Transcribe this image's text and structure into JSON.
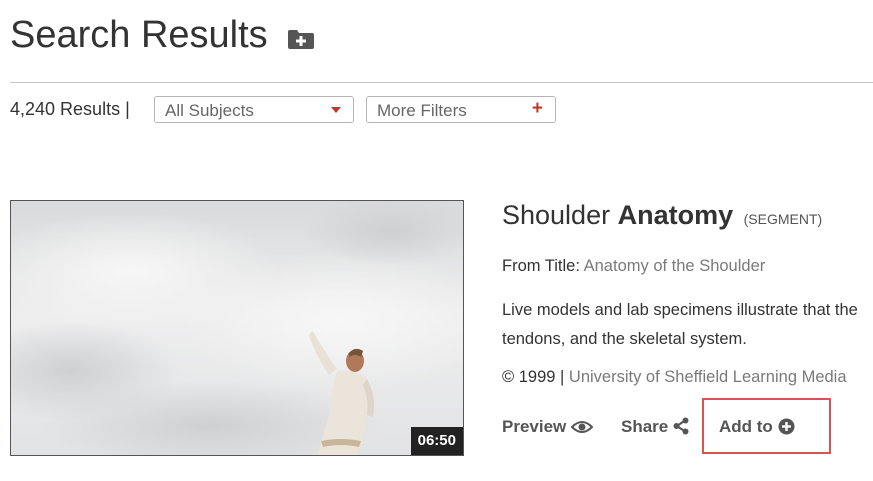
{
  "header": {
    "title": "Search Results",
    "folder_icon": "folder-plus-icon"
  },
  "toolbar": {
    "results_count": "4,240 Results |",
    "subjects_filter": {
      "label": "All Subjects",
      "icon": "chevron-down-icon",
      "color": "#c0392b"
    },
    "more_filters": {
      "label": "More Filters",
      "icon": "plus-icon",
      "color": "#c0392b"
    }
  },
  "result": {
    "duration": "06:50",
    "title_prefix": "Shoulder",
    "title_bold": "Anatomy",
    "type": "(SEGMENT)",
    "from_label": "From Title:",
    "from_value": "Anatomy of the Shoulder",
    "description_lines": [
      "Live models and lab specimens illustrate that the",
      "tendons, and the skeletal system."
    ],
    "copyright": "© 1999 |",
    "publisher": "University of Sheffield Learning Media",
    "actions": {
      "preview": {
        "label": "Preview",
        "icon": "eye-icon"
      },
      "share": {
        "label": "Share",
        "icon": "share-icon"
      },
      "add_to": {
        "label": "Add to",
        "icon": "plus-circle-icon",
        "highlight_color": "#d9534f"
      }
    }
  }
}
